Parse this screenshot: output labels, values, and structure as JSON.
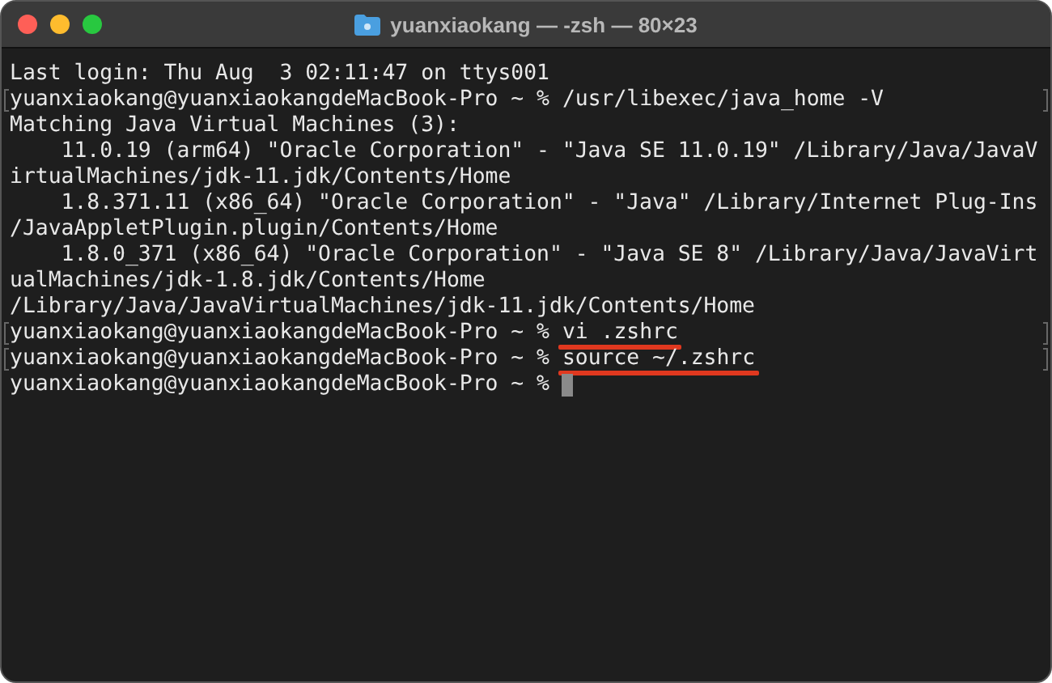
{
  "window": {
    "title": "yuanxiaokang — -zsh — 80×23"
  },
  "lines": [
    {
      "kind": "output",
      "text": "Last login: Thu Aug  3 02:11:47 on ttys001",
      "marked": false
    },
    {
      "kind": "prompt",
      "prompt": "yuanxiaokang@yuanxiaokangdeMacBook-Pro ~ %",
      "command": "/usr/libexec/java_home -V",
      "underlined": false,
      "marked": true
    },
    {
      "kind": "output",
      "text": "Matching Java Virtual Machines (3):",
      "marked": false
    },
    {
      "kind": "output",
      "text": "    11.0.19 (arm64) \"Oracle Corporation\" - \"Java SE 11.0.19\" /Library/Java/JavaV",
      "marked": false
    },
    {
      "kind": "output",
      "text": "irtualMachines/jdk-11.jdk/Contents/Home",
      "marked": false
    },
    {
      "kind": "output",
      "text": "    1.8.371.11 (x86_64) \"Oracle Corporation\" - \"Java\" /Library/Internet Plug-Ins",
      "marked": false
    },
    {
      "kind": "output",
      "text": "/JavaAppletPlugin.plugin/Contents/Home",
      "marked": false
    },
    {
      "kind": "output",
      "text": "    1.8.0_371 (x86_64) \"Oracle Corporation\" - \"Java SE 8\" /Library/Java/JavaVirt",
      "marked": false
    },
    {
      "kind": "output",
      "text": "ualMachines/jdk-1.8.jdk/Contents/Home",
      "marked": false
    },
    {
      "kind": "output",
      "text": "/Library/Java/JavaVirtualMachines/jdk-11.jdk/Contents/Home",
      "marked": false
    },
    {
      "kind": "prompt",
      "prompt": "yuanxiaokang@yuanxiaokangdeMacBook-Pro ~ %",
      "command": "vi .zshrc",
      "underlined": true,
      "marked": true
    },
    {
      "kind": "prompt",
      "prompt": "yuanxiaokang@yuanxiaokangdeMacBook-Pro ~ %",
      "command": "source ~/.zshrc",
      "underlined": true,
      "marked": true
    },
    {
      "kind": "prompt",
      "prompt": "yuanxiaokang@yuanxiaokangdeMacBook-Pro ~ %",
      "cursor": true
    }
  ]
}
